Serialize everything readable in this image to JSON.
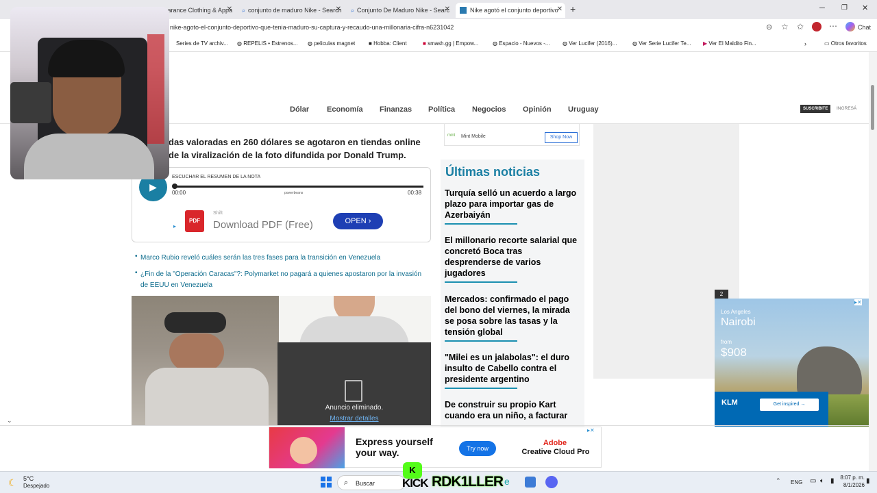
{
  "browser": {
    "tabs": [
      {
        "label": "Clearance Clothing & Appa"
      },
      {
        "label": "conjunto de maduro Nike - Search"
      },
      {
        "label": "Conjunto De Maduro Nike - Searc"
      },
      {
        "label": "Nike agotó el conjunto deportivo"
      }
    ],
    "url": "nike-agoto-el-conjunto-deportivo-que-tenia-maduro-su-captura-y-recaudo-una-millonaria-cifra-n6231042",
    "chat_label": "Chat",
    "bookmarks": [
      "Series de TV archiv...",
      "REPELIS • Estrenos...",
      "peliculas magnet",
      "Hobba: Client",
      "smash.gg | Empow...",
      "Espacio - Nuevos -...",
      "Ver Lucifer (2016)...",
      "Ver Serie Lucifer Te...",
      "Ver El Maldito Fin...",
      "Otros favoritos"
    ]
  },
  "site": {
    "nav": [
      "Dólar",
      "Economía",
      "Finanzas",
      "Política",
      "Negocios",
      "Opinión",
      "Uruguay"
    ],
    "subscribe": "SUSCRIBITE",
    "login": "INGRESÁ"
  },
  "article": {
    "lead_line1": "das valoradas en 260 dólares se agotaron en tiendas online",
    "lead_line2": "de la viralización de la foto difundida por Donald Trump.",
    "audio": {
      "label": "ESCUCHAR EL RESUMEN DE LA NOTA",
      "start": "00:00",
      "end": "00:38",
      "brand": "powerbeans"
    },
    "ad_pdf": {
      "brand": "Shift",
      "text": "Download PDF (Free)",
      "button": "OPEN",
      "icon": "PDF"
    },
    "related": [
      "Marco Rubio reveló cuáles serán las tres fases para la transición en Venezuela",
      "¿Fin de la \"Operación Caracas\"?: Polymarket no pagará a quienes apostaron por la invasión de EEUU en Venezuela"
    ],
    "ad_removed": "Anuncio eliminado.",
    "ad_details": "Mostrar detalles"
  },
  "sidebar": {
    "mint_label": "Mint Mobile",
    "shop_now": "Shop Now",
    "heading": "Últimas noticias",
    "news": [
      "Turquía selló un acuerdo a largo plazo para importar gas de Azerbaiyán",
      "El millonario recorte salarial que concretó Boca tras desprenderse de varios jugadores",
      "Mercados: confirmado el pago del bono del viernes, la mirada se posa sobre las tasas y la tensión global",
      "\"Milei es un jalabolas\": el duro insulto de Cabello contra el presidente argentino",
      "De construir su propio Kart cuando era un niño, a facturar"
    ]
  },
  "ad_klm": {
    "badge": "2",
    "from_city": "Los Angeles",
    "to_city": "Nairobi",
    "from": "from",
    "price": "$908",
    "cta": "Get inspired",
    "brand": "KLM"
  },
  "ad_adobe": {
    "line1": "Express yourself",
    "line2": "your way.",
    "button": "Try now",
    "brand1": "Adobe",
    "brand2": "Creative Cloud Pro"
  },
  "taskbar": {
    "temp": "5°C",
    "weather": "Despejado",
    "search": "Buscar",
    "overlay": "RDK1LLER",
    "kick": "KICK",
    "lang": "ENG",
    "time": "8:07 p. m.",
    "date": "8/1/2026"
  },
  "colors": {
    "accent": "#1a7fa3",
    "open_button": "#1e3fb4",
    "pdf_red": "#d9262b"
  }
}
